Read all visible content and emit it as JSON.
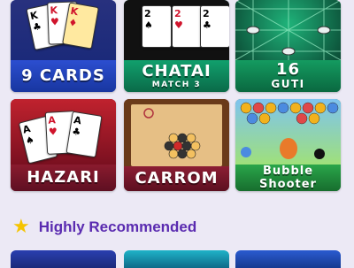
{
  "games": [
    {
      "title": "9 CARDS",
      "subtitle": "",
      "colors": {
        "label": "#1e3fb5",
        "art": "#1b2a7a"
      }
    },
    {
      "title": "CHATAI",
      "subtitle": "MATCH 3",
      "colors": {
        "label": "#0c7a55",
        "art": "#1a1a1a"
      }
    },
    {
      "title": "16",
      "subtitle": "GUTI",
      "colors": {
        "label": "#0f7a4a",
        "art": "#0e5a3a"
      }
    },
    {
      "title": "HAZARI",
      "subtitle": "",
      "colors": {
        "label": "#7a1630",
        "art": "#a8192e"
      }
    },
    {
      "title": "CARROM",
      "subtitle": "",
      "colors": {
        "label": "#7a1a2e",
        "art": "#b08050"
      }
    },
    {
      "title": "Bubble",
      "subtitle": "Shooter",
      "colors": {
        "label": "#1f8a3a",
        "art": "#7ec3f0"
      }
    }
  ],
  "section": {
    "title": "Highly Recommended",
    "icon": "star-icon"
  },
  "card_ranks": {
    "k": "K",
    "a": "A",
    "two": "2"
  }
}
